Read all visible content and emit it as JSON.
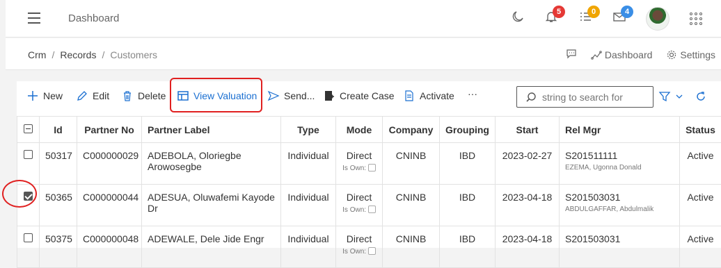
{
  "header": {
    "title": "Dashboard",
    "notifications": {
      "bell_count": "5",
      "tasks_count": "0",
      "mail_count": "4"
    },
    "badge_colors": {
      "bell": "#e53935",
      "tasks": "#f0a500",
      "mail": "#3a8ee6"
    }
  },
  "breadcrumb": {
    "items": [
      "Crm",
      "Records",
      "Customers"
    ],
    "right": {
      "dashboard_label": "Dashboard",
      "settings_label": "Settings"
    }
  },
  "toolbar": {
    "new_label": "New",
    "edit_label": "Edit",
    "delete_label": "Delete",
    "view_valuation_label": "View Valuation",
    "send_label": "Send...",
    "create_case_label": "Create Case",
    "activate_label": "Activate",
    "more_label": "···",
    "search_placeholder": "string to search for"
  },
  "table": {
    "columns": [
      "Id",
      "Partner No",
      "Partner Label",
      "Type",
      "Mode",
      "Company",
      "Grouping",
      "Start",
      "Rel Mgr",
      "Status"
    ],
    "is_own_label": "Is Own:",
    "rows": [
      {
        "checked": false,
        "id": "50317",
        "partner_no": "C000000029",
        "label": "ADEBOLA, Oloriegbe Arowosegbe",
        "type": "Individual",
        "mode": "Direct",
        "company": "CNINB",
        "grouping": "IBD",
        "start": "2023-02-27",
        "rel_mgr": "S201511111",
        "rel_mgr_name": "EZEMA, Ugonna Donald",
        "status": "Active"
      },
      {
        "checked": true,
        "id": "50365",
        "partner_no": "C000000044",
        "label": "ADESUA, Oluwafemi Kayode Dr",
        "type": "Individual",
        "mode": "Direct",
        "company": "CNINB",
        "grouping": "IBD",
        "start": "2023-04-18",
        "rel_mgr": "S201503031",
        "rel_mgr_name": "ABDULGAFFAR, Abdulmalik",
        "status": "Active"
      },
      {
        "checked": false,
        "id": "50375",
        "partner_no": "C000000048",
        "label": "ADEWALE, Dele Jide Engr",
        "type": "Individual",
        "mode": "Direct",
        "company": "CNINB",
        "grouping": "IBD",
        "start": "2023-04-18",
        "rel_mgr": "S201503031",
        "rel_mgr_name": "",
        "status": "Active"
      }
    ]
  },
  "accent_color": "#1a6fd1",
  "annotation_color": "#e02020"
}
